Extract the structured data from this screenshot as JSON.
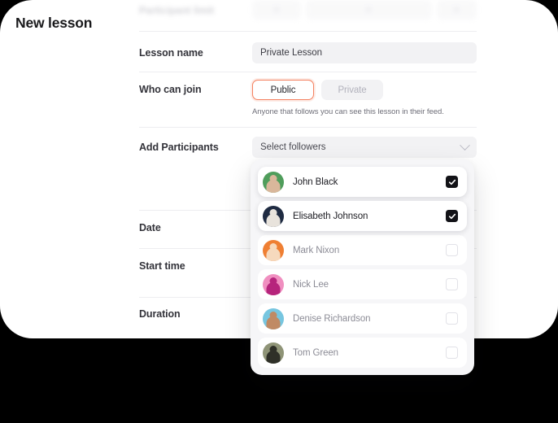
{
  "page": {
    "title": "New lesson"
  },
  "colors": {
    "accent": "#f4805f",
    "card_bg": "#ffffff",
    "page_bg": "#000000",
    "field_bg": "#f2f2f4",
    "checkbox_on": "#121217"
  },
  "form": {
    "rows": [
      {
        "label": "Participant limit",
        "type": "ghost"
      },
      {
        "label": "Lesson name",
        "type": "text",
        "value": "Private Lesson"
      },
      {
        "label": "Who can join",
        "type": "segmented",
        "options": [
          "Public",
          "Private"
        ],
        "selected": "Public",
        "hint": "Anyone that follows you can see this lesson in their feed."
      },
      {
        "label": "Add Participants",
        "type": "select",
        "value": "Select followers"
      },
      {
        "label": "Date",
        "type": "hidden"
      },
      {
        "label": "Start time",
        "type": "hidden"
      },
      {
        "label": "Duration",
        "type": "hidden"
      }
    ]
  },
  "dropdown": {
    "options": [
      {
        "name": "John Black",
        "checked": true,
        "avatar": "#4f9d5b",
        "avatar2": "#d9b79b"
      },
      {
        "name": "Elisabeth Johnson",
        "checked": true,
        "avatar": "#1f2b42",
        "avatar2": "#e8e3dc"
      },
      {
        "name": "Mark Nixon",
        "checked": false,
        "avatar": "#ef7f33",
        "avatar2": "#f6d9bd"
      },
      {
        "name": "Nick Lee",
        "checked": false,
        "avatar": "#f08fc0",
        "avatar2": "#b6247c"
      },
      {
        "name": "Denise Richardson",
        "checked": false,
        "avatar": "#77c6e0",
        "avatar2": "#c08a64"
      },
      {
        "name": "Tom Green",
        "checked": false,
        "avatar": "#8f9477",
        "avatar2": "#2f3028"
      }
    ],
    "checkbox_checked_icon": "check-icon",
    "chevron_icon": "chevron-down-icon"
  }
}
